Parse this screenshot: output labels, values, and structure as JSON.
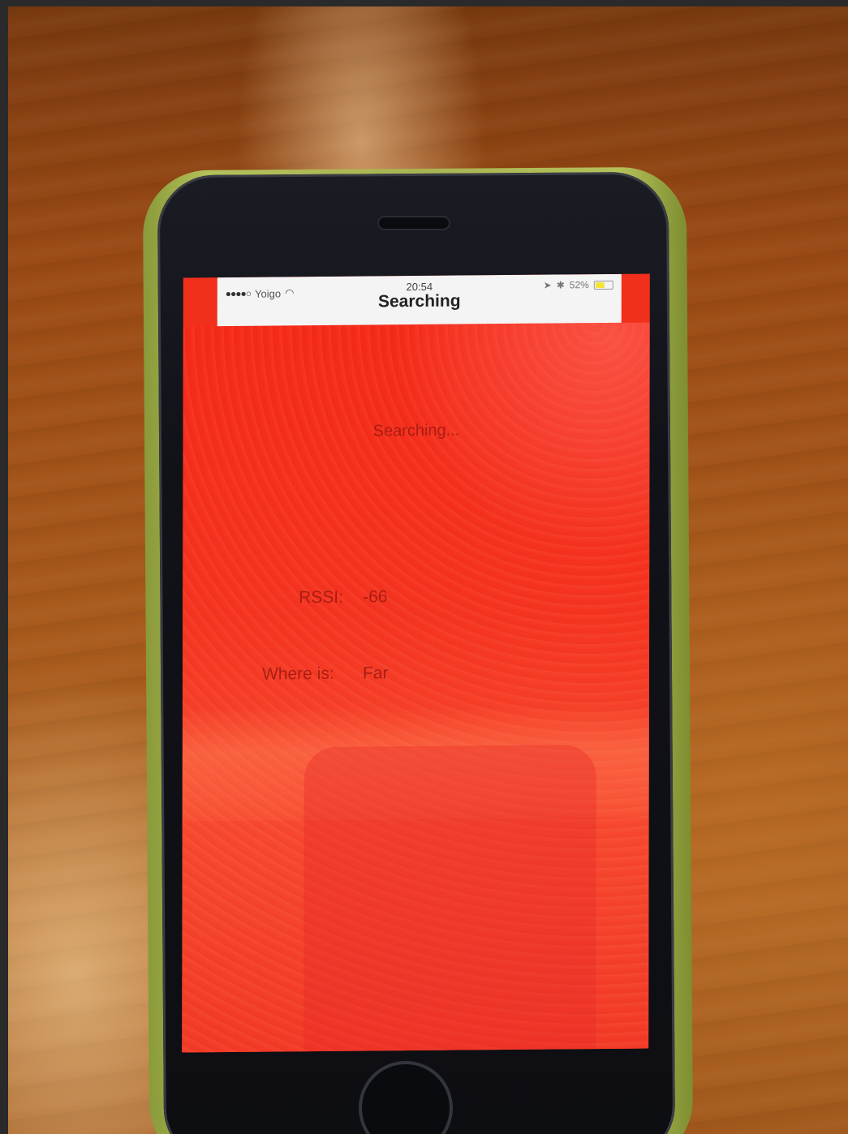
{
  "status_bar": {
    "carrier": "Yoigo",
    "signal_dots": "●●●●○",
    "time": "20:54",
    "bluetooth": "✱",
    "location": "➤",
    "battery_percent": "52%",
    "battery_level": 0.52
  },
  "nav": {
    "title": "Searching"
  },
  "main": {
    "status_text": "Searching...",
    "rssi_label": "RSSI:",
    "rssi_value": "-66",
    "where_label": "Where is:",
    "where_value": "Far"
  },
  "colors": {
    "background": "#f0301c",
    "text": "#9a1a12",
    "battery": "#f4e43a"
  }
}
